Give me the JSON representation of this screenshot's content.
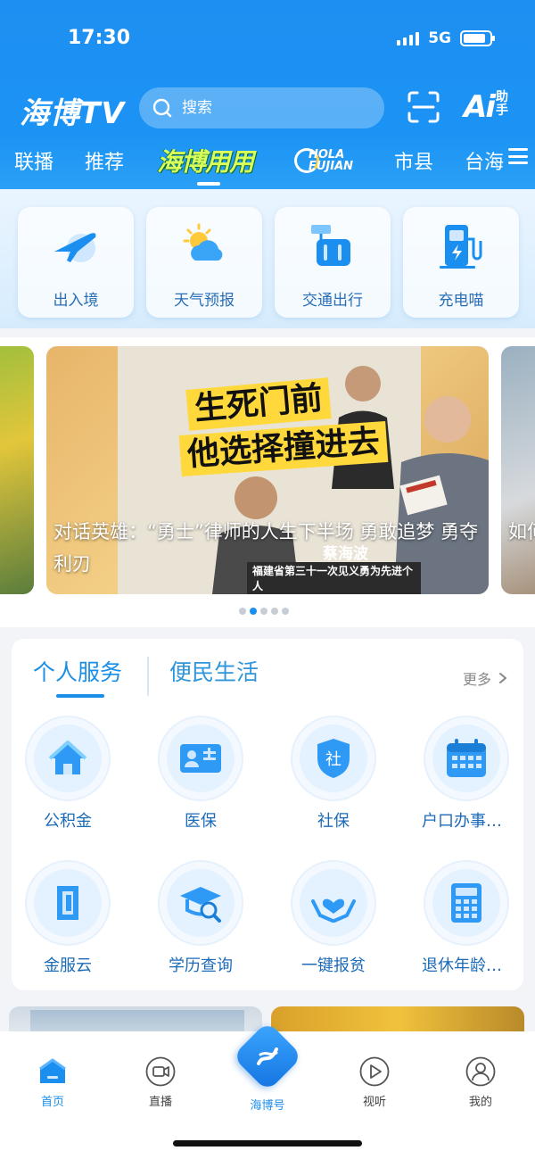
{
  "status_bar": {
    "time": "17:30",
    "network": "5G"
  },
  "header": {
    "logo": "海博TV",
    "search_placeholder": "搜索",
    "ai_label": "Ai",
    "ai_sub_top": "助",
    "ai_sub_bottom": "手"
  },
  "channels": {
    "items": [
      "联播",
      "推荐",
      "海博用用",
      "市县",
      "台海"
    ],
    "hola_line1": "HOLA",
    "hola_line2": "FUJIAN",
    "active": "海博用用"
  },
  "quick_services": [
    {
      "label": "出入境",
      "icon": "airplane-icon"
    },
    {
      "label": "天气预报",
      "icon": "weather-icon"
    },
    {
      "label": "交通出行",
      "icon": "luggage-icon"
    },
    {
      "label": "充电喵",
      "icon": "charging-station-icon"
    }
  ],
  "carousel": {
    "headline_line1": "生死门前",
    "headline_line2": "他选择撞进去",
    "person_name": "蔡海波",
    "award_text": "福建省第三十一次见义勇为先进个人",
    "caption": "对话英雄：“勇士”律师的人生下半场 勇敢追梦 勇夺利刃",
    "next_caption": "如何痛后",
    "slide_count": 5,
    "active_index": 1
  },
  "service_card": {
    "tabs": [
      "个人服务",
      "便民生活"
    ],
    "active_tab": "个人服务",
    "more_label": "更多",
    "items": [
      {
        "label": "公积金",
        "icon": "house-icon"
      },
      {
        "label": "医保",
        "icon": "id-card-icon"
      },
      {
        "label": "社保",
        "icon": "shield-icon"
      },
      {
        "label": "户口办事指南",
        "icon": "calendar-icon"
      },
      {
        "label": "金服云",
        "icon": "cloud-finance-icon"
      },
      {
        "label": "学历查询",
        "icon": "graduation-cap-icon"
      },
      {
        "label": "一键报贫",
        "icon": "heart-hands-icon"
      },
      {
        "label": "退休年龄计算",
        "icon": "calculator-icon"
      }
    ],
    "shield_char": "社"
  },
  "tab_bar": {
    "items": [
      "首页",
      "直播",
      "海博号",
      "视听",
      "我的"
    ],
    "active": "首页"
  },
  "colors": {
    "brand_blue": "#1b8ff0",
    "service_text": "#1c6bb8"
  }
}
